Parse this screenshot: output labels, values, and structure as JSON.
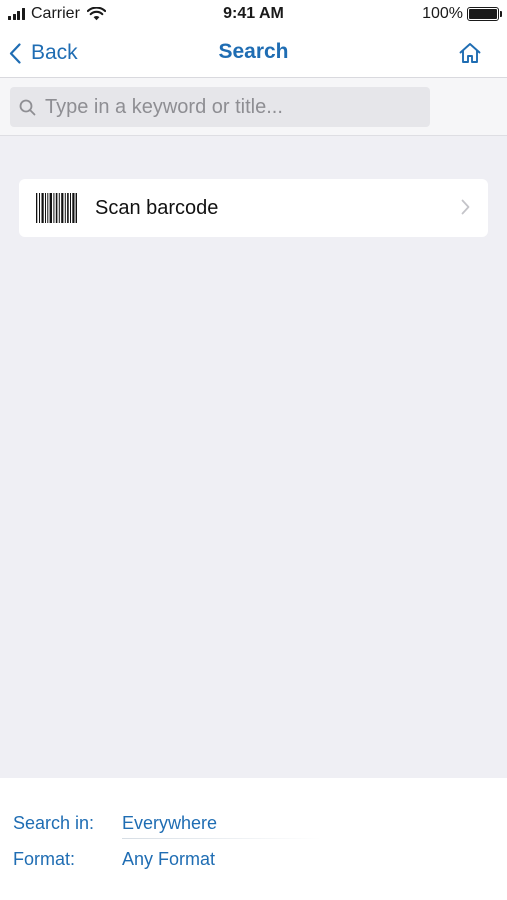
{
  "status_bar": {
    "carrier": "Carrier",
    "time": "9:41 AM",
    "battery": "100%",
    "battery_level": 1.0
  },
  "nav": {
    "back_label": "Back",
    "title": "Search",
    "back_icon": "chevron-left-icon",
    "home_icon": "home-icon"
  },
  "search": {
    "placeholder": "Type in a keyword or title...",
    "value": "",
    "icon": "search-icon"
  },
  "scan": {
    "label": "Scan barcode",
    "icon": "barcode-icon"
  },
  "filters": {
    "search_in_label": "Search in:",
    "search_in_value": "Everywhere",
    "format_label": "Format:",
    "format_value": "Any Format"
  },
  "colors": {
    "accent": "#1f6db3",
    "background": "#efeff4",
    "surface": "#ffffff"
  }
}
